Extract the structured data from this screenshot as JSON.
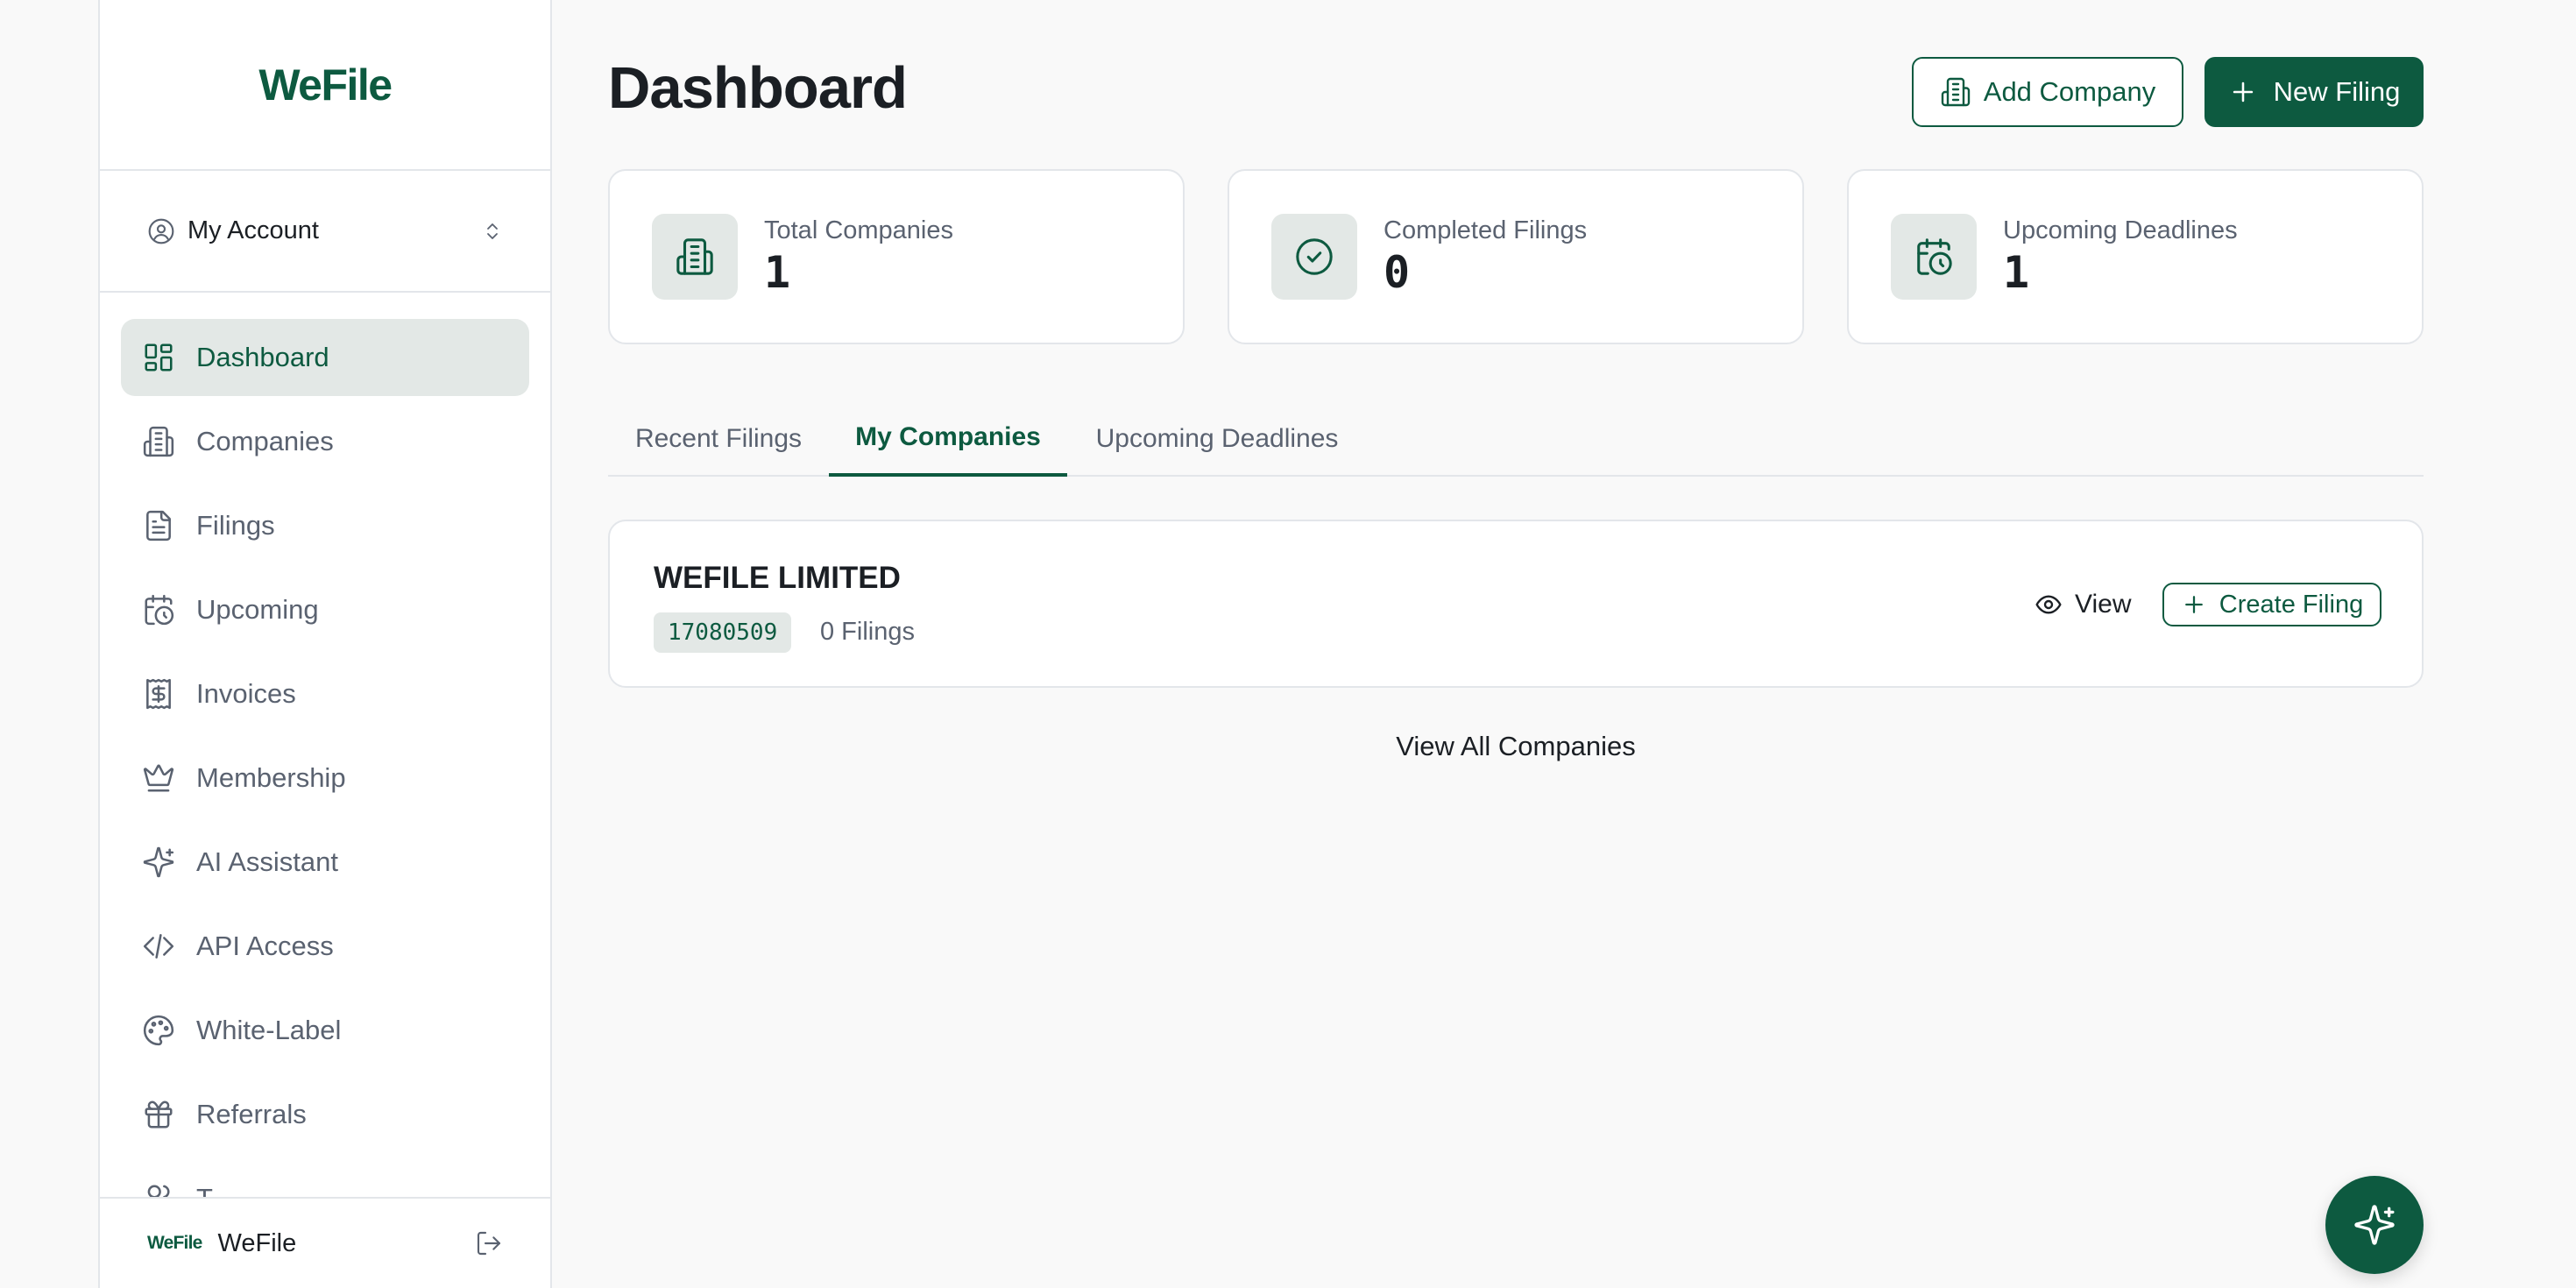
{
  "brand": {
    "logo_text": "WeFile",
    "primary_color": "#0d5a40",
    "accent_bg": "#e3e8e6"
  },
  "sidebar": {
    "account_label": "My Account",
    "items": [
      {
        "label": "Dashboard",
        "icon": "layout-dashboard-icon",
        "active": true
      },
      {
        "label": "Companies",
        "icon": "building-icon"
      },
      {
        "label": "Filings",
        "icon": "file-text-icon"
      },
      {
        "label": "Upcoming",
        "icon": "calendar-clock-icon"
      },
      {
        "label": "Invoices",
        "icon": "receipt-dollar-icon"
      },
      {
        "label": "Membership",
        "icon": "crown-icon"
      },
      {
        "label": "AI Assistant",
        "icon": "sparkles-icon"
      },
      {
        "label": "API Access",
        "icon": "code-icon"
      },
      {
        "label": "White-Label",
        "icon": "palette-icon"
      },
      {
        "label": "Referrals",
        "icon": "gift-icon"
      },
      {
        "label": "T",
        "icon": "users-icon"
      }
    ],
    "footer": {
      "logo_text": "WeFile",
      "name": "WeFile",
      "logout_icon": "logout-icon"
    }
  },
  "header": {
    "title": "Dashboard",
    "add_company_label": "Add Company",
    "new_filing_label": "New Filing"
  },
  "stats": [
    {
      "label": "Total Companies",
      "value": "1",
      "icon": "building-icon"
    },
    {
      "label": "Completed Filings",
      "value": "0",
      "icon": "check-circle-icon"
    },
    {
      "label": "Upcoming Deadlines",
      "value": "1",
      "icon": "calendar-clock-icon"
    }
  ],
  "tabs": [
    {
      "label": "Recent Filings",
      "active": false
    },
    {
      "label": "My Companies",
      "active": true
    },
    {
      "label": "Upcoming Deadlines",
      "active": false
    }
  ],
  "companies": [
    {
      "name": "WEFILE LIMITED",
      "number": "17080509",
      "filings": "0 Filings",
      "view_label": "View",
      "create_label": "Create Filing"
    }
  ],
  "view_all_label": "View All Companies",
  "fab_icon": "sparkles-icon"
}
